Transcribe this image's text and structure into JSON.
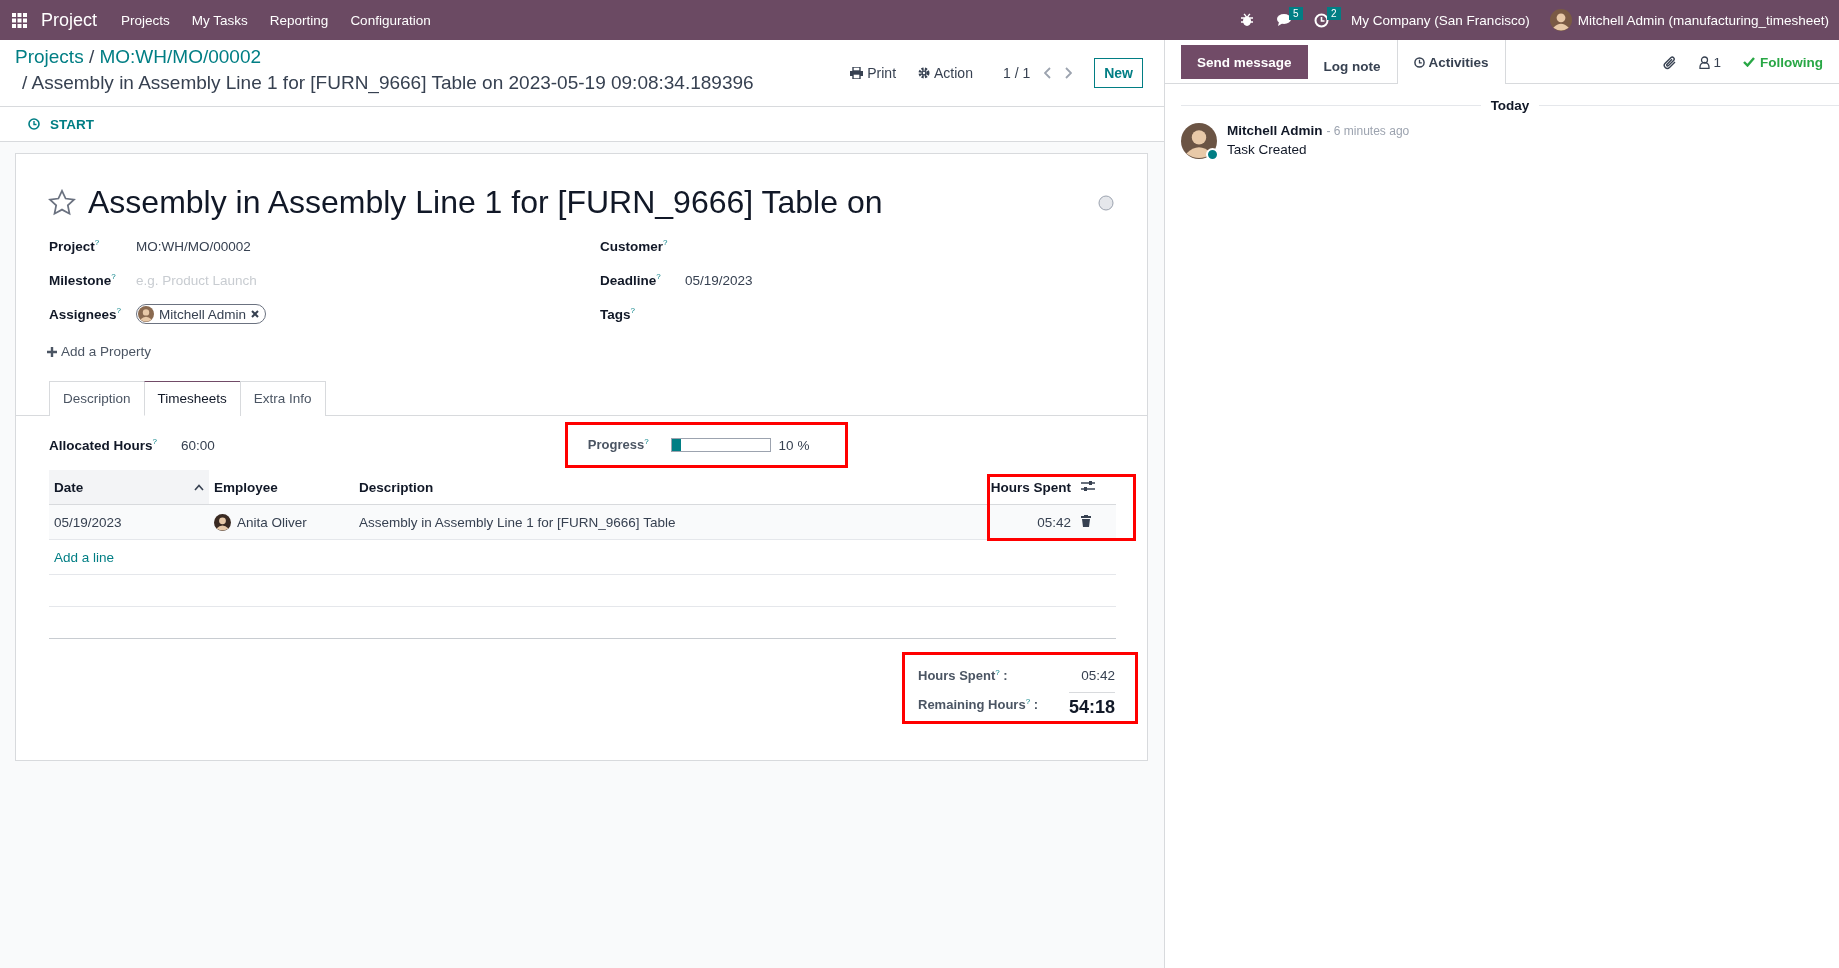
{
  "navbar": {
    "app": "Project",
    "menu": [
      "Projects",
      "My Tasks",
      "Reporting",
      "Configuration"
    ],
    "messages_badge": "5",
    "activities_badge": "2",
    "company": "My Company (San Francisco)",
    "user": "Mitchell Admin (manufacturing_timesheet)"
  },
  "breadcrumb": {
    "separator": "/",
    "items": [
      "Projects",
      "MO:WH/MO/00002"
    ],
    "current": "Assembly in Assembly Line 1 for [FURN_9666] Table on 2023-05-19 09:08:34.189396"
  },
  "actions": {
    "print": "Print",
    "action": "Action",
    "pager": "1 / 1",
    "new": "New"
  },
  "status_bar": {
    "start": "START"
  },
  "task": {
    "starred": false,
    "title": "Assembly in Assembly Line 1 for [FURN_9666] Table on",
    "fields_left": [
      {
        "kind": "text",
        "label": "Project$^{?}$",
        "value": "MO:WH/MO/00002"
      },
      {
        "kind": "placeholder",
        "label": "Milestone$^{?}$",
        "placeholder": "e.g. Product Launch"
      },
      {
        "kind": "tags",
        "label": "Assignees$^{?}$",
        "tags": [
          "Mitchell Admin"
        ]
      }
    ],
    "fields_right": [
      {
        "kind": "empty",
        "label": "Customer$^{?}$"
      },
      {
        "kind": "text",
        "label": "Deadline$^{?}$",
        "value": "05/19/2023"
      },
      {
        "kind": "empty",
        "label": "Tags$^{?}$"
      }
    ],
    "add_property": "Add a Property",
    "tabs": [
      {
        "label": "Description",
        "selected": false
      },
      {
        "label": "Timesheets",
        "selected": true
      },
      {
        "label": "Extra Info",
        "selected": false
      }
    ]
  },
  "timesheets": {
    "allocated_label": "Allocated Hours$^{?}$",
    "allocated": "60:00",
    "progress_label": "Progress$^{?}$",
    "progress": {
      "level": 0.1,
      "reading": "10 %"
    },
    "columns": [
      "Date",
      "Employee",
      "Description",
      "Hours Spent"
    ],
    "rows": [
      {
        "date": "05/19/2023",
        "employee": "Anita Oliver",
        "description": "Assembly in Assembly Line 1 for [FURN_9666] Table",
        "hours": "05:42"
      }
    ],
    "add_line": "Add a line",
    "totals": [
      {
        "kind": "sum",
        "label": "Hours Spent$^{?}$ :",
        "value": "05:42"
      },
      {
        "kind": "remaining",
        "label": "Remaining Hours$^{?}$ :",
        "value": "54:18"
      }
    ]
  },
  "chatter": {
    "buttons": [
      "Send message",
      "Log note",
      "Activities"
    ],
    "followers": "1",
    "following": true,
    "following_label": "Following",
    "separator": "Today",
    "messages": [
      {
        "author": "Mitchell Admin",
        "time": "- 6 minutes ago",
        "body": "Task Created",
        "online": true
      }
    ]
  }
}
